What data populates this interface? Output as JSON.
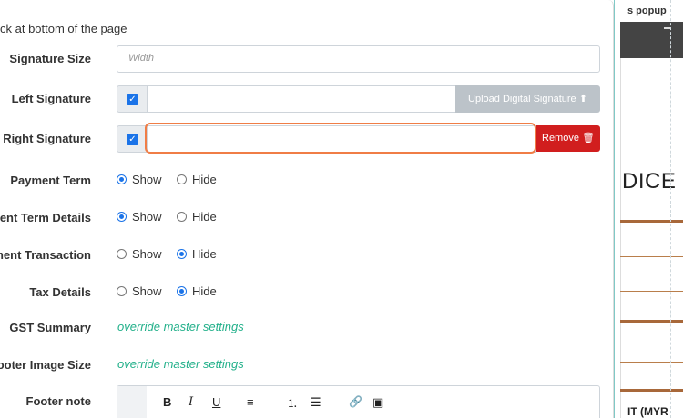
{
  "background": {
    "header_text": "s popup",
    "invoice_title": "DICE",
    "bottom_text": "IT (MYR"
  },
  "top_note": "ck at bottom of the page",
  "signature_size": {
    "label": "Signature Size",
    "placeholder": "Width"
  },
  "left_signature": {
    "label": "Left Signature",
    "checked": true,
    "upload_label": "Upload Digital Signature",
    "upload_icon": "upload-icon"
  },
  "right_signature": {
    "label": "Right Signature",
    "checked": true,
    "remove_label": "Remove",
    "remove_icon": "trash-icon"
  },
  "rows": [
    {
      "label": "Payment Term",
      "show": "Show",
      "hide": "Hide",
      "selected": "show"
    },
    {
      "label": "ent Term Details",
      "show": "Show",
      "hide": "Hide",
      "selected": "show"
    },
    {
      "label": "ment Transaction",
      "show": "Show",
      "hide": "Hide",
      "selected": "hide"
    },
    {
      "label": "Tax Details",
      "show": "Show",
      "hide": "Hide",
      "selected": "hide"
    }
  ],
  "gst_summary": {
    "label": "GST Summary",
    "link": "override master settings"
  },
  "footer_image_size": {
    "label": "ooter Image Size",
    "link": "override master settings"
  },
  "footer_note": {
    "label": "Footer note"
  },
  "toolbar": {
    "bold": "B",
    "italic": "I",
    "underline": "U",
    "align": "≡",
    "ordered_list": "⒈",
    "bullet_list": "☰",
    "link": "🔗",
    "image": "▣"
  },
  "colors": {
    "accent": "#1a73e8",
    "danger": "#d11e1e",
    "highlight": "#f07d46",
    "link": "#22b08a"
  }
}
